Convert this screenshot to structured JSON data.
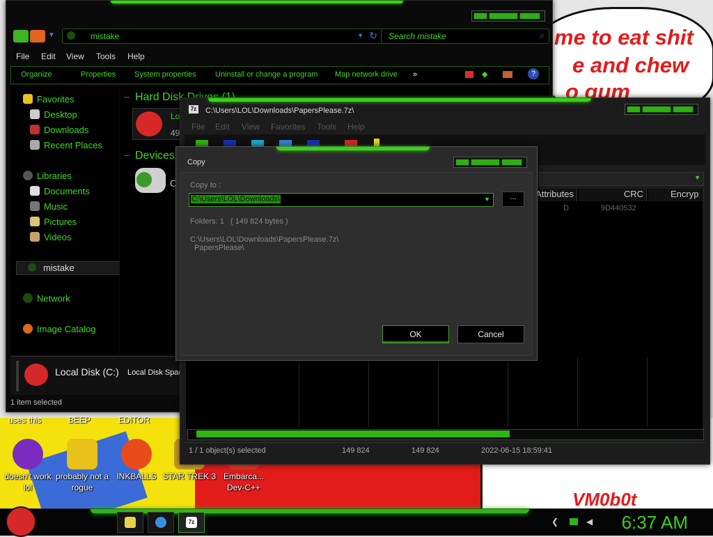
{
  "wallpaper": {
    "bubble_line1": "me to eat shit",
    "bubble_line2": "e and chew",
    "bubble_line3": "o gum",
    "signature": "VM0b0t"
  },
  "desktop": {
    "row1_labels": [
      "uses this",
      "BEEP",
      "EDITOR"
    ],
    "icons": [
      {
        "label": "doesn't work lol",
        "icon": "yahoo-messenger-icon",
        "color": "#7b2bbf"
      },
      {
        "label": "probably not a rogue",
        "icon": "gear-program-icon",
        "color": "#e8c21a"
      },
      {
        "label": "INKBALLS",
        "icon": "inkball-icon",
        "color": "#e84a1a"
      },
      {
        "label": "STAR TREK 3",
        "icon": "star-trek-icon",
        "color": "#c99a25"
      },
      {
        "label": "Embarca... Dev-C++",
        "icon": "dev-cpp-icon",
        "color": "#d63a2a"
      }
    ]
  },
  "explorer": {
    "address": "mistake",
    "search_placeholder": "Search mistake",
    "menu": [
      "File",
      "Edit",
      "View",
      "Tools",
      "Help"
    ],
    "commands": [
      "Organize",
      "Properties",
      "System properties",
      "Uninstall or change a program",
      "Map network drive",
      "»"
    ],
    "nav": {
      "favorites": "Favorites",
      "desktop": "Desktop",
      "downloads": "Downloads",
      "recent": "Recent Places",
      "libraries": "Libraries",
      "documents": "Documents",
      "music": "Music",
      "pictures": "Pictures",
      "videos": "Videos",
      "computer": "mistake",
      "network": "Network",
      "image_catalog": "Image Catalog"
    },
    "groups": {
      "hard_disk": "Hard Disk Drives (1)",
      "drive_name_partial": "Lo",
      "drive_size_partial": "49",
      "devices": "Devices",
      "device_partial": "C"
    },
    "details": {
      "name": "Local Disk (C:)",
      "sub": "Local Disk Space"
    },
    "status": "1 item selected"
  },
  "sevenzip": {
    "title": "C:\\Users\\LOL\\Downloads\\PapersPlease.7z\\",
    "menu": [
      "File",
      "Edit",
      "View",
      "Favorites",
      "Tools",
      "Help"
    ],
    "columns": [
      "Attributes",
      "CRC",
      "Encryp"
    ],
    "row": {
      "attributes": "D",
      "crc": "9D440532"
    },
    "status": {
      "selected": "1 / 1 object(s) selected",
      "size": "149 824",
      "packed": "149 824",
      "modified": "2022-06-15 18:59:41"
    },
    "scroll_position": 0.62
  },
  "copy_dialog": {
    "title": "Copy",
    "copy_to_label": "Copy to :",
    "destination": "C:\\Users\\LOL\\Downloads\\",
    "browse_label": "...",
    "folders": "Folders: 1",
    "bytes": "( 149 824 bytes )",
    "source_line1": "C:\\Users\\LOL\\Downloads\\PapersPlease.7z\\",
    "source_line2": "PapersPlease\\",
    "ok": "OK",
    "cancel": "Cancel"
  },
  "taskbar": {
    "clock": "6:37 AM",
    "apps": [
      {
        "name": "explorer-taskbar-button",
        "color": "#e7d24a"
      },
      {
        "name": "chrome-taskbar-button",
        "color": "#3a8de0"
      },
      {
        "name": "7zip-taskbar-button",
        "color": "#ffffff"
      }
    ],
    "sevenzip_label": "7z"
  },
  "colors": {
    "accent": "#39d21b",
    "background": "#0a0a0a"
  }
}
